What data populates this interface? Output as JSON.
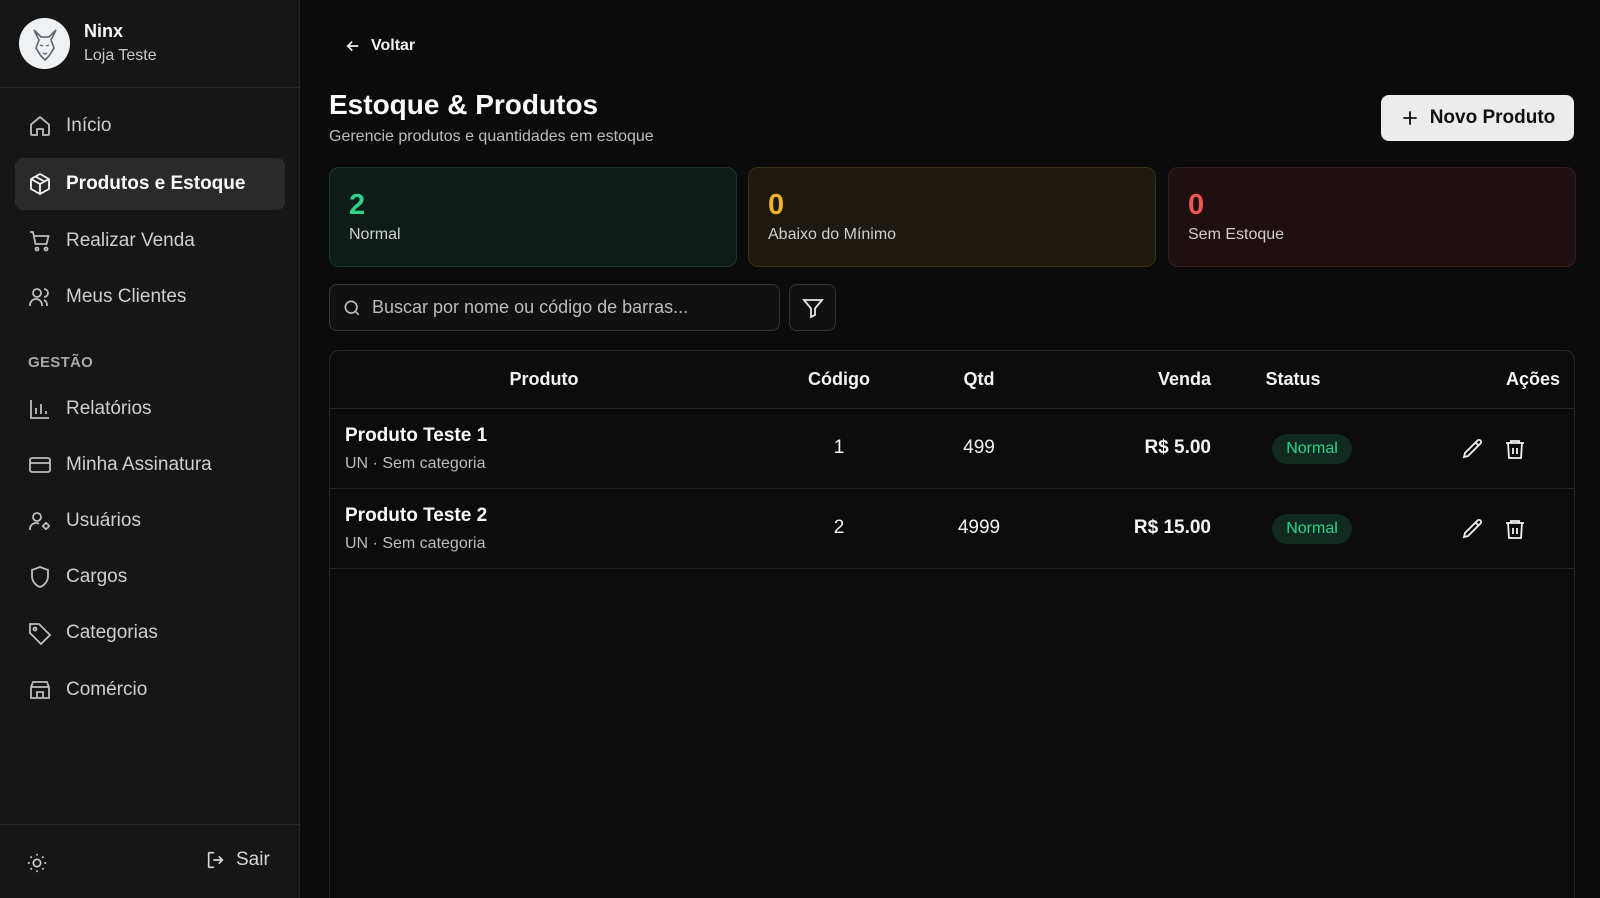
{
  "sidebar": {
    "user": {
      "name": "Ninx",
      "store": "Loja Teste"
    },
    "nav": [
      {
        "label": "Início",
        "icon": "home-icon"
      },
      {
        "label": "Produtos e Estoque",
        "icon": "box-icon",
        "active": true
      },
      {
        "label": "Realizar Venda",
        "icon": "cart-icon"
      },
      {
        "label": "Meus Clientes",
        "icon": "users-icon"
      }
    ],
    "section_label": "GESTÃO",
    "management": [
      {
        "label": "Relatórios",
        "icon": "bar-chart-icon"
      },
      {
        "label": "Minha Assinatura",
        "icon": "credit-card-icon"
      },
      {
        "label": "Usuários",
        "icon": "user-cog-icon"
      },
      {
        "label": "Cargos",
        "icon": "shield-icon"
      },
      {
        "label": "Categorias",
        "icon": "tag-icon"
      },
      {
        "label": "Comércio",
        "icon": "store-icon"
      }
    ],
    "logout_label": "Sair"
  },
  "header": {
    "back_label": "Voltar",
    "title": "Estoque & Produtos",
    "subtitle": "Gerencie produtos e quantidades em estoque",
    "new_button": "Novo Produto"
  },
  "stats": [
    {
      "value": "2",
      "label": "Normal",
      "color": "#2bd58a"
    },
    {
      "value": "0",
      "label": "Abaixo do Mínimo",
      "color": "#f0b429"
    },
    {
      "value": "0",
      "label": "Sem Estoque",
      "color": "#ef5555"
    }
  ],
  "search": {
    "placeholder": "Buscar por nome ou código de barras..."
  },
  "table": {
    "columns": [
      "Produto",
      "Código",
      "Qtd",
      "Venda",
      "Status",
      "Ações"
    ],
    "rows": [
      {
        "name": "Produto Teste 1",
        "meta": "UN · Sem categoria",
        "code": "1",
        "qty": "499",
        "price": "R$ 5.00",
        "status": "Normal"
      },
      {
        "name": "Produto Teste 2",
        "meta": "UN · Sem categoria",
        "code": "2",
        "qty": "4999",
        "price": "R$ 15.00",
        "status": "Normal"
      }
    ]
  }
}
